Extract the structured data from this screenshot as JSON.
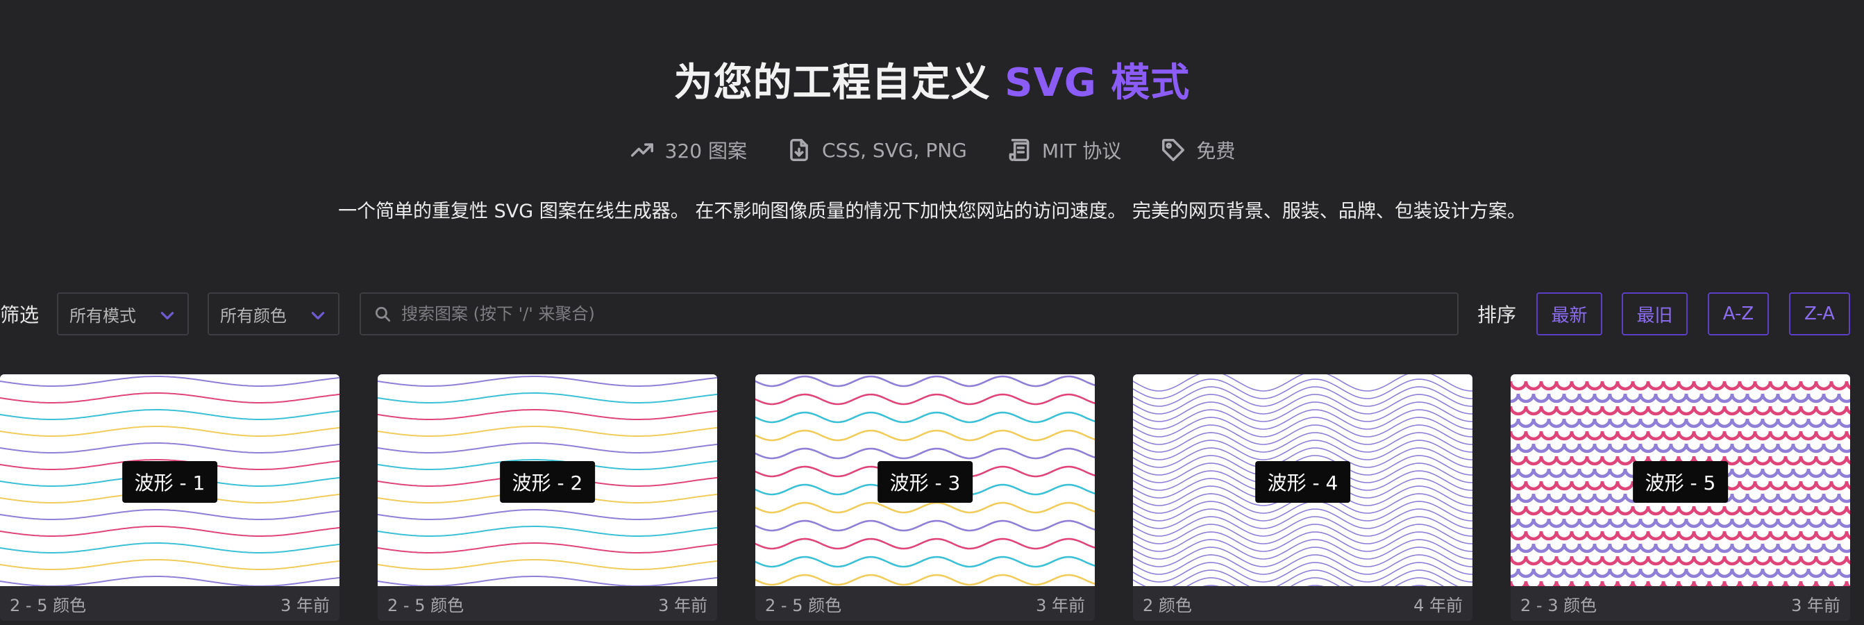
{
  "hero": {
    "title_main": "为您的工程自定义 ",
    "title_accent": "SVG 模式"
  },
  "stats": [
    {
      "icon": "trending-up-icon",
      "label": "320 图案"
    },
    {
      "icon": "file-download-icon",
      "label": "CSS, SVG, PNG"
    },
    {
      "icon": "license-scroll-icon",
      "label": "MIT 协议"
    },
    {
      "icon": "price-tag-icon",
      "label": "免费"
    }
  ],
  "description": "一个简单的重复性 SVG 图案在线生成器。 在不影响图像质量的情况下加快您网站的访问速度。 完美的网页背景、服装、品牌、包装设计方案。",
  "filter": {
    "label": "筛选",
    "mode_select": "所有模式",
    "color_select": "所有颜色",
    "search_placeholder": "搜索图案 (按下 '/' 来聚合)"
  },
  "sort": {
    "label": "排序",
    "options": [
      "最新",
      "最旧",
      "A-Z",
      "Z-A"
    ]
  },
  "cards": [
    {
      "name": "波形 - 1",
      "colors": "2 - 5 颜色",
      "age": "3 年前"
    },
    {
      "name": "波形 - 2",
      "colors": "2 - 5 颜色",
      "age": "3 年前"
    },
    {
      "name": "波形 - 3",
      "colors": "2 - 5 颜色",
      "age": "3 年前"
    },
    {
      "name": "波形 - 4",
      "colors": "2 颜色",
      "age": "4 年前"
    },
    {
      "name": "波形 - 5",
      "colors": "2 - 3 颜色",
      "age": "3 年前"
    }
  ],
  "colors": {
    "background": "#242427",
    "accent": "#8b5cf6",
    "wave_purple": "#8f7fd6",
    "wave_pink": "#e0457a",
    "wave_cyan": "#3cc0d6",
    "wave_yellow": "#f0cc5c"
  }
}
